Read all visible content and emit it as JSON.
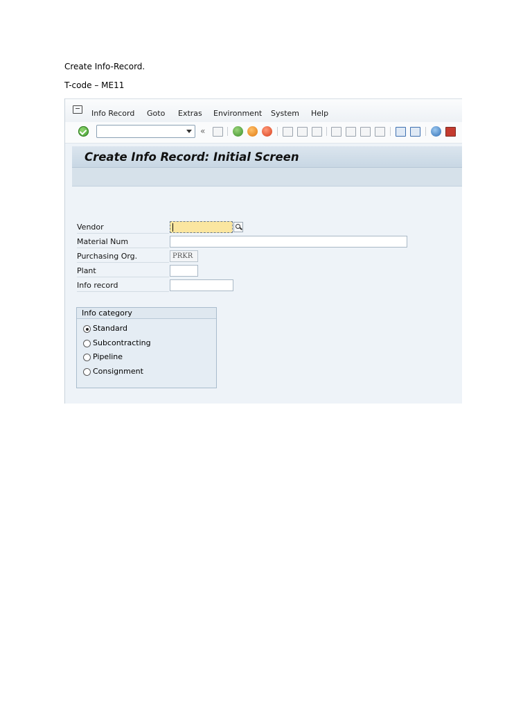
{
  "document": {
    "line1": "Create Info-Record.",
    "line2": "T-code – ME11"
  },
  "sap": {
    "menu": [
      "Info Record",
      "Goto",
      "Extras",
      "Environment",
      "System",
      "Help"
    ],
    "toolbar": {
      "icons": [
        "ok-icon",
        "command-field",
        "back-arrows-icon",
        "save-icon",
        "back-icon",
        "exit-icon",
        "cancel-icon",
        "print-icon",
        "find-icon",
        "find-next-icon",
        "first-page-icon",
        "previous-page-icon",
        "next-page-icon",
        "last-page-icon",
        "create-session-icon",
        "shortcut-icon",
        "help-icon",
        "customize-layout-icon"
      ]
    },
    "screen_title": "Create Info Record: Initial Screen",
    "fields": {
      "vendor": {
        "label": "Vendor",
        "value": ""
      },
      "material": {
        "label": "Material Num",
        "value": ""
      },
      "purch_org": {
        "label": "Purchasing Org.",
        "value": "PRKR"
      },
      "plant": {
        "label": "Plant",
        "value": ""
      },
      "info_record": {
        "label": "Info record",
        "value": ""
      }
    },
    "info_category": {
      "title": "Info category",
      "options": [
        "Standard",
        "Subcontracting",
        "Pipeline",
        "Consignment"
      ],
      "selected": "Standard"
    },
    "colors": {
      "title_bar": "#c8d7e4",
      "focused_input": "#fbe6a0",
      "background": "#eef3f8"
    }
  }
}
